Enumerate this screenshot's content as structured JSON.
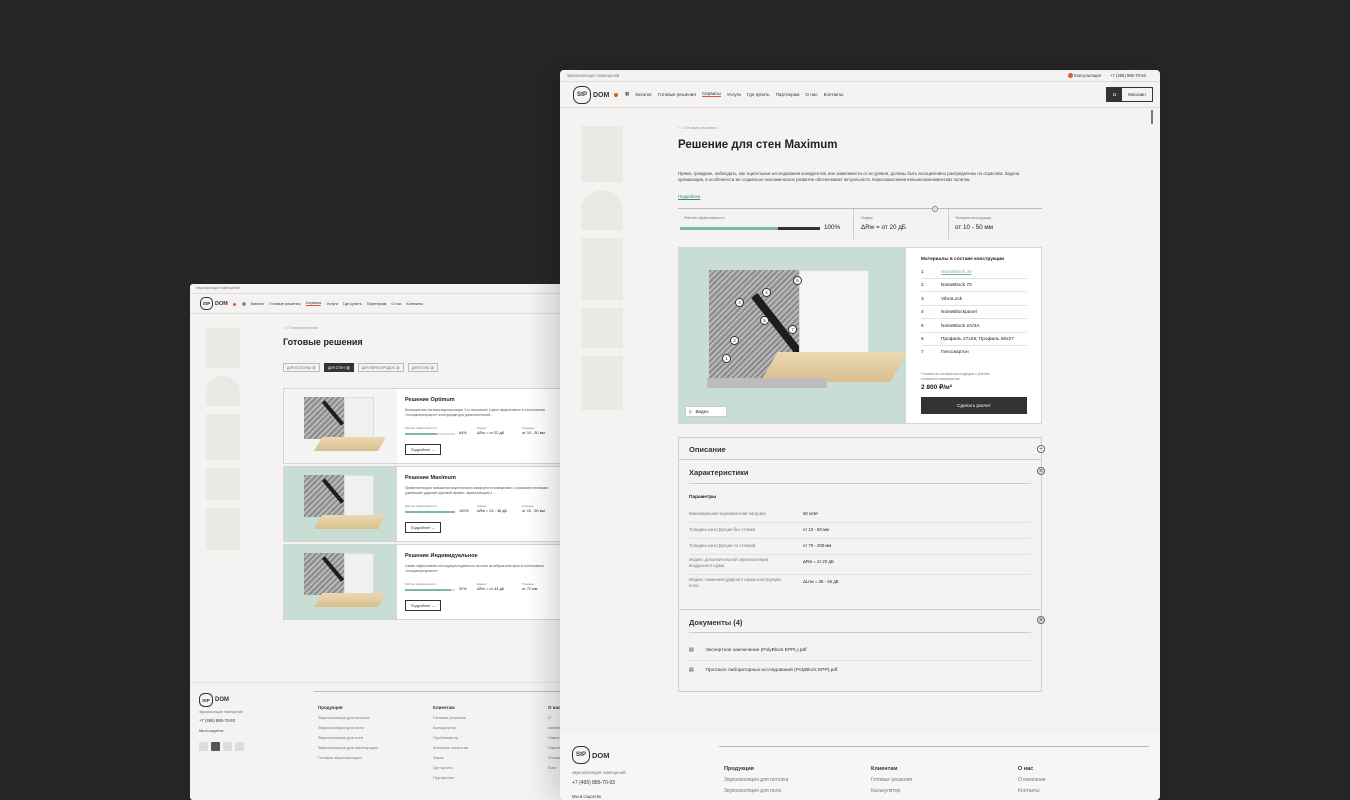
{
  "brand": {
    "logo_mark": "StP",
    "logo_word": "DOM",
    "tagline": "звукоизоляция помещений",
    "phone": "+7 (495) 885-70-93",
    "accent": "#e05a2b",
    "progress_color": "#7fb8a0"
  },
  "nav": {
    "catalog": "Каталог",
    "solutions": "Готовые решения",
    "services": "Сервисы",
    "service": "Услуги",
    "where_buy": "Где купить",
    "partners": "Партнерам",
    "about": "О нас",
    "contacts": "Контакты"
  },
  "topbar": {
    "consult": "Консультация",
    "phone": "+7 (495) 885-70-93"
  },
  "left": {
    "breadcrumb": "/ Готовые решения",
    "title": "Готовые решения",
    "filters": [
      {
        "label": "ДЛЯ ПОТОЛКА",
        "count": "3"
      },
      {
        "label": "ДЛЯ СТЕН",
        "count": "3"
      },
      {
        "label": "ДЛЯ ПЕРЕГОРОДОК",
        "count": "3"
      },
      {
        "label": "ДЛЯ ПОЛА",
        "count": "3"
      }
    ],
    "cards": [
      {
        "title": "Решение Optimum",
        "desc": "Бескаркасная система звукоизоляции 3-го поколения! Самое эффективное в соотношении «толщина/результат» конструкции для дополнительной...",
        "eff_label": "Рейтинг эффективности",
        "eff": "64%",
        "eff_value": 0.64,
        "idx_label": "Индекс",
        "idx": "ΔRw = от 22 дБ",
        "th_label": "Толщина",
        "th": "от 10 - 50 мм",
        "more": "Подробнее"
      },
      {
        "title": "Решение Maximum",
        "desc": "Применяется для повышения акустического комфорта в помещениях с сильными потолками (уменьшает ударный шумовой эффект, звукоизоляция) к ...",
        "eff_label": "Рейтинг эффективности",
        "eff": "100%",
        "eff_value": 1.0,
        "idx_label": "Индекс",
        "idx": "ΔRw = 24 - 38 дБ",
        "th_label": "Толщина",
        "th": "от 10 - 50 мм",
        "more": "Подробнее"
      },
      {
        "title": "Решение Индивидуальное",
        "desc": "Самая эффективная конструкция подвесного потолка на виброизоляторах в соотношении «толщина/результат»",
        "eff_label": "Рейтинг эффективности",
        "eff": "92%",
        "eff_value": 0.92,
        "idx_label": "Индекс",
        "idx": "ΔRw = от 44 дБ",
        "th_label": "Толщина",
        "th": "от 72 мм",
        "more": "Подробнее"
      }
    ],
    "footer": {
      "social_label": "Мы в соцсетях",
      "col1_title": "Продукция",
      "col1": [
        "Звукоизоляция для потолка",
        "Звукоизоляция для пола",
        "Звукоизоляция для стен",
        "Звукоизоляция для перегородок",
        "Готовые звукоизоляции"
      ],
      "col2_title": "Клиентам",
      "col2": [
        "Готовые решения",
        "Калькулятор",
        "Проблематор",
        "Контроль качества",
        "Заказ",
        "Где купить",
        "Портфолио"
      ],
      "col3_title": "О нас",
      "col3": [
        "О компании",
        "Новости",
        "Партнерам",
        "Отзывы",
        "Блог"
      ]
    }
  },
  "right": {
    "breadcrumb": "/ Готовые решения",
    "title": "Решение для стен Maximum",
    "intro": "Прямо, граждане, наблюдать, как тщательные исследования конкурентов, вне зависимости от их уровня, должны быть ассоциативно распределены по отраслям. Задача организации, в особенности же социально-экономическое развитие обеспечивает актуальность переосмысления внешнеэкономических политик.",
    "more_link": "Подробнее",
    "stats": {
      "eff_label": "Рейтинг эффективности",
      "eff": "100%",
      "eff_value": 1.0,
      "idx_label": "Индекс",
      "idx": "ΔRw = от 20 дБ",
      "th_label": "Толщина конструкции",
      "th": "от 10 - 50 мм"
    },
    "video": "Видео",
    "materials_title": "Материалы в составе конструкции",
    "materials": [
      {
        "n": "1",
        "name": "NoiseBlock 30"
      },
      {
        "n": "2",
        "name": "NoiseBlock 70"
      },
      {
        "n": "3",
        "name": "VibroLock"
      },
      {
        "n": "4",
        "name": "NoiseBlockpanel"
      },
      {
        "n": "5",
        "name": "NoiseBlock 2A/3A"
      },
      {
        "n": "6",
        "name": "Профиль 27x28; Профиль 60x27"
      },
      {
        "n": "7",
        "name": "Гипсокартон"
      }
    ],
    "price_label": "Стоимость готовой конструкции с учетом стоимости материалов",
    "price": "2 800 ₽/м²",
    "calc_btn": "Сделать расчет",
    "callouts": [
      "1",
      "2",
      "3",
      "4",
      "5",
      "6",
      "7"
    ],
    "desc_title": "Описание",
    "char_title": "Характеристики",
    "params_title": "Параметры",
    "params": [
      {
        "k": "Максимальная equivalентная нагрузка",
        "v": "60 кг/м²"
      },
      {
        "k": "Толщина конструкции без стяжки",
        "v": "от 10 - 50 мм"
      },
      {
        "k": "Толщина конструкции со стяжкой",
        "v": "от 70 - 200 мм"
      },
      {
        "k": "Индекс дополнительной звукоизоляции воздушного шума",
        "v": "ΔRw = от 20 дБ"
      },
      {
        "k": "Индекс снижения ударного шума конструкции пола",
        "v": "ΔLnw = 36 - 46 дБ"
      }
    ],
    "docs_title": "Документы (4)",
    "docs": [
      "Экспертное заключение (PolyBlock EPPL).pdf",
      "Протокол лабораторных исследований (PolyBlock EPP).pdf"
    ],
    "shop_btn": "Магазин",
    "footer": {
      "col1_title": "Продукция",
      "col1": [
        "Звукоизоляция для потолка",
        "Звукоизоляция для пола"
      ],
      "col2_title": "Клиентам",
      "col2": [
        "Готовые решения",
        "Калькулятор"
      ],
      "col3_title": "О нас",
      "col3": [
        "О компании",
        "Контакты"
      ],
      "social_label": "Мы в соцсетях"
    }
  }
}
